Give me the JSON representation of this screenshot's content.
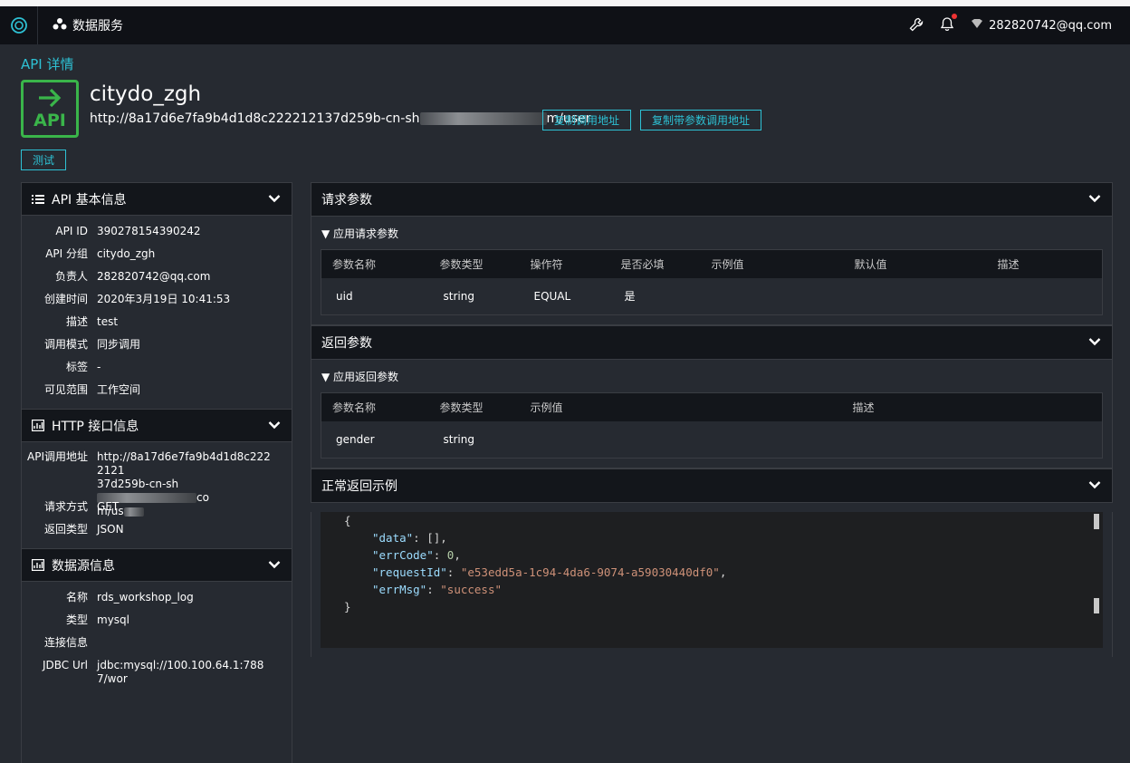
{
  "nav": {
    "service_label": "数据服务",
    "user_email": "282820742@qq.com"
  },
  "page": {
    "crumb": "API 详情",
    "badge_text": "API",
    "api_name": "citydo_zgh",
    "url_prefix": "http://8a17d6e7fa9b4d1d8c222212137d259b-cn-sh",
    "url_suffix": "m/user",
    "copy_url_label": "复制调用地址",
    "copy_url_params_label": "复制带参数调用地址",
    "test_label": "测试"
  },
  "basic_info": {
    "title": "API 基本信息",
    "rows": [
      {
        "k": "API ID",
        "v": "390278154390242"
      },
      {
        "k": "API 分组",
        "v": "citydo_zgh"
      },
      {
        "k": "负责人",
        "v": "282820742@qq.com"
      },
      {
        "k": "创建时间",
        "v": "2020年3月19日 10:41:53"
      },
      {
        "k": "描述",
        "v": "test"
      },
      {
        "k": "调用模式",
        "v": "同步调用"
      },
      {
        "k": "标签",
        "v": "-"
      },
      {
        "k": "可见范围",
        "v": "工作空间"
      }
    ]
  },
  "http_info": {
    "title": "HTTP 接口信息",
    "url_key": "API调用地址",
    "url_line1": "http://8a17d6e7fa9b4d1d8c2222121",
    "url_line2a": "37d259b-cn-sh",
    "url_line2b": "co",
    "url_line3": "m/us",
    "method_key": "请求方式",
    "method_val": "GET",
    "return_key": "返回类型",
    "return_val": "JSON"
  },
  "datasource": {
    "title": "数据源信息",
    "rows": [
      {
        "k": "名称",
        "v": "rds_workshop_log"
      },
      {
        "k": "类型",
        "v": "mysql"
      },
      {
        "k": "连接信息",
        "v": ""
      },
      {
        "k": "JDBC Url",
        "v": "jdbc:mysql://100.100.64.1:7887/wor"
      }
    ]
  },
  "request": {
    "title": "请求参数",
    "sub": "▼ 应用请求参数",
    "headers": [
      "参数名称",
      "参数类型",
      "操作符",
      "是否必填",
      "示例值",
      "默认值",
      "描述"
    ],
    "rows": [
      [
        "uid",
        "string",
        "EQUAL",
        "是",
        "",
        "",
        ""
      ]
    ]
  },
  "response": {
    "title": "返回参数",
    "sub": "▼ 应用返回参数",
    "headers": [
      "参数名称",
      "参数类型",
      "示例值",
      "描述"
    ],
    "rows": [
      [
        "gender",
        "string",
        "",
        ""
      ]
    ]
  },
  "example": {
    "title": "正常返回示例",
    "open": "{",
    "k1": "\"data\"",
    "v1": "[]",
    "k2": "\"errCode\"",
    "v2": "0",
    "k3": "\"requestId\"",
    "v3": "\"e53edd5a-1c94-4da6-9074-a59030440df0\"",
    "k4": "\"errMsg\"",
    "v4": "\"success\"",
    "close": "}"
  },
  "colors": {
    "accent": "#2ec1d4",
    "badge": "#3ab54a",
    "bg": "#262a31",
    "header": "#13161b"
  }
}
